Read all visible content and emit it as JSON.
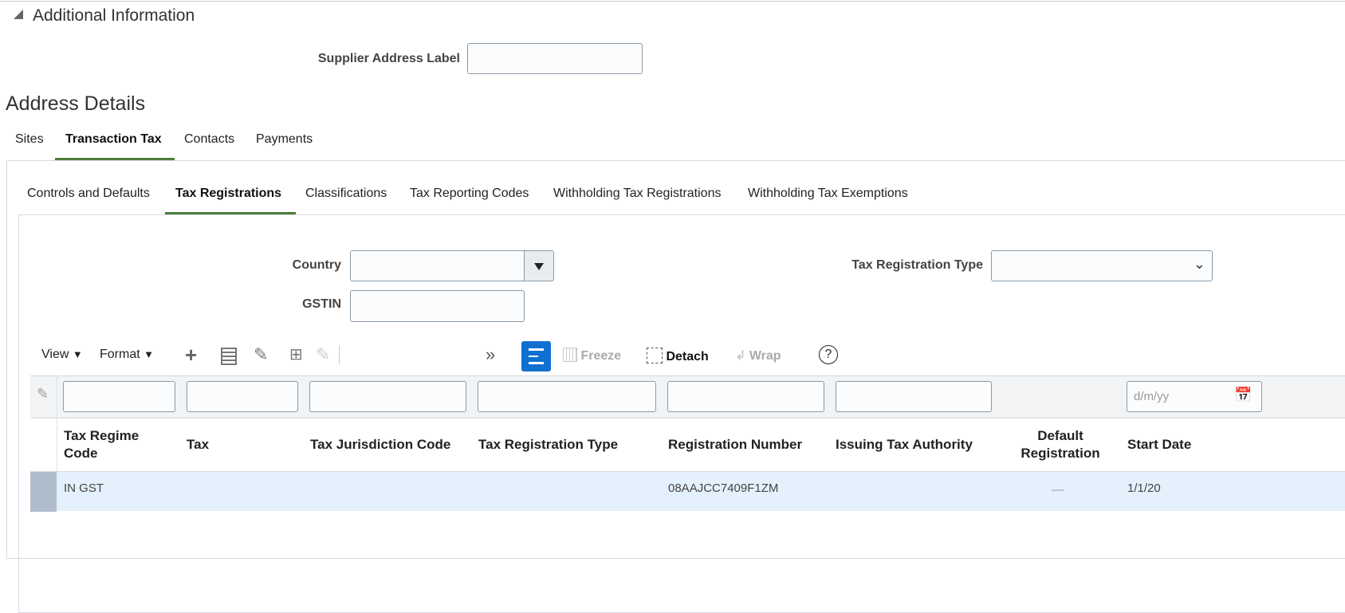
{
  "additional_info": {
    "title": "Additional Information",
    "supplier_address_label": "Supplier Address Label",
    "supplier_address_value": ""
  },
  "address_details": {
    "title": "Address Details",
    "tabs": [
      {
        "label": "Sites"
      },
      {
        "label": "Transaction Tax"
      },
      {
        "label": "Contacts"
      },
      {
        "label": "Payments"
      }
    ]
  },
  "subtabs": [
    {
      "label": "Controls and Defaults"
    },
    {
      "label": "Tax Registrations"
    },
    {
      "label": "Classifications"
    },
    {
      "label": "Tax Reporting Codes"
    },
    {
      "label": "Withholding Tax Registrations"
    },
    {
      "label": "Withholding Tax Exemptions"
    }
  ],
  "search": {
    "country_label": "Country",
    "country_value": "",
    "tax_reg_type_label": "Tax Registration Type",
    "tax_reg_type_value": "",
    "gstin_label": "GSTIN",
    "gstin_value": ""
  },
  "toolbar": {
    "view": "View",
    "format": "Format",
    "freeze": "Freeze",
    "detach": "Detach",
    "wrap": "Wrap",
    "overflow": "»",
    "help": "?"
  },
  "table": {
    "date_placeholder": "d/m/yy",
    "columns": [
      "Tax Regime Code",
      "Tax",
      "Tax Jurisdiction Code",
      "Tax Registration Type",
      "Registration Number",
      "Issuing Tax Authority",
      "Default Registration",
      "Start Date"
    ],
    "rows": [
      {
        "regime": "IN GST",
        "tax": "",
        "jurisdiction": "",
        "reg_type": "",
        "reg_number": "08AAJCC7409F1ZM",
        "authority": "",
        "default": "—",
        "start_date": "1/1/20"
      }
    ]
  },
  "colors": {
    "accent": "#4f7d3b",
    "selected_row": "#e4f0fb",
    "filter_btn": "#0f70d0"
  }
}
